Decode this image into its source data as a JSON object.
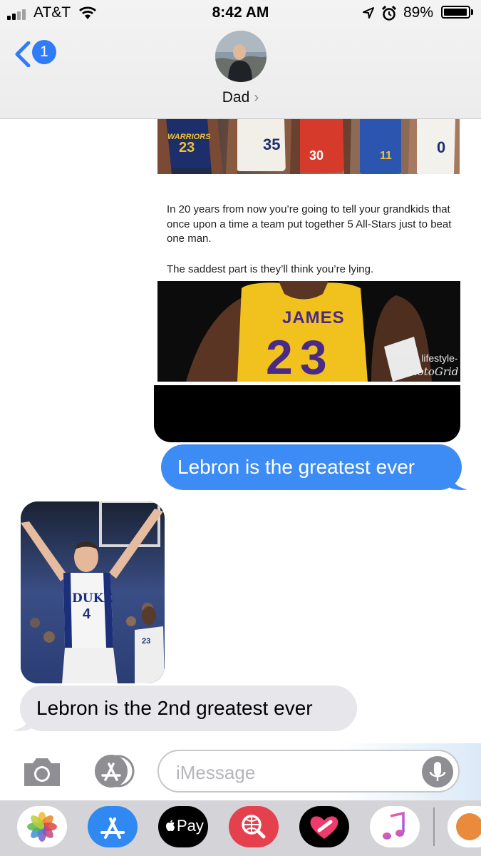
{
  "status_bar": {
    "carrier": "AT&T",
    "time": "8:42 AM",
    "battery_percent": "89%",
    "battery_level": 0.89,
    "icons": [
      "signal-icon",
      "wifi-icon",
      "location-arrow-icon",
      "alarm-icon",
      "battery-icon"
    ]
  },
  "header": {
    "back_badge": "1",
    "contact_name": "Dad",
    "chevron": "›"
  },
  "thread": {
    "shared_image_top": {
      "jersey_numbers": [
        "23",
        "35",
        "30",
        "11",
        "0"
      ],
      "team_text": "WARRIORS"
    },
    "shared_post": {
      "text_1": "In 20 years from now you’re going to tell your grandkids that once upon a time a team put together 5 All-Stars just to beat one man.",
      "text_2": "The saddest part is they’ll think you’re lying.",
      "jersey_name": "JAMES",
      "jersey_number": "23",
      "watermark_1": "-kwaku lifestyle-",
      "watermark_2": "PhotoGrid"
    },
    "sent_message": "Lebron is the greatest ever",
    "received_photo": {
      "jersey_team": "DUKE",
      "jersey_number": "4",
      "background_number": "23"
    },
    "received_message": "Lebron is the 2nd greatest ever"
  },
  "input_bar": {
    "placeholder": "iMessage",
    "icons": [
      "camera-icon",
      "app-store-icon",
      "microphone-icon"
    ]
  },
  "app_drawer": {
    "apps": [
      {
        "name": "Photos",
        "icon": "photos-icon"
      },
      {
        "name": "App Store",
        "icon": "app-store-icon"
      },
      {
        "name": "Apple Pay",
        "label": "Pay",
        "icon": "apple-pay-icon"
      },
      {
        "name": "Search",
        "icon": "web-search-icon"
      },
      {
        "name": "Digital Touch",
        "icon": "digital-touch-icon"
      },
      {
        "name": "Music",
        "icon": "music-icon"
      },
      {
        "name": "More",
        "icon": "app-icon"
      }
    ],
    "colors": {
      "photos_bg": "#ffffff",
      "app_store_bg": "#2f89f0",
      "apple_pay_bg": "#000000",
      "search_bg": "#e5404e",
      "digital_touch_bg": "#000000",
      "music_bg": "#ffffff",
      "more_bg": "#e98a3d"
    }
  },
  "colors": {
    "outgoing_bubble": "#3d8cf5",
    "incoming_bubble": "#e6e6eb",
    "accent": "#2f7cf6"
  }
}
